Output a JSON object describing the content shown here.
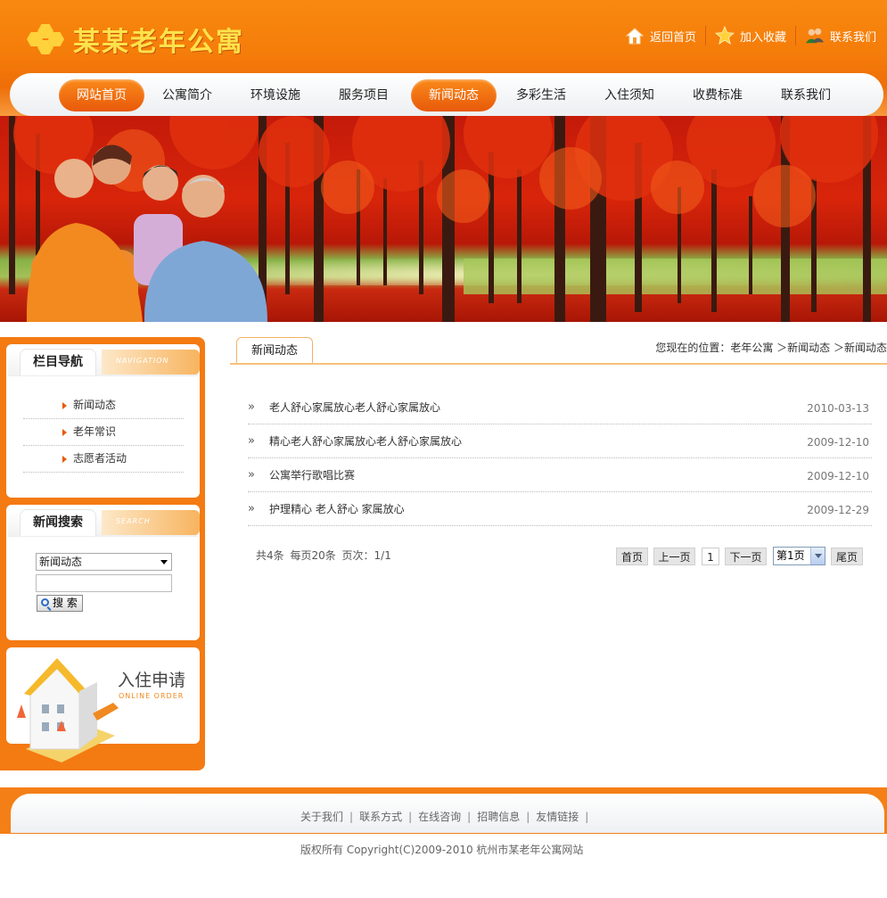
{
  "site": {
    "logo_text": "某某老年公寓",
    "top_links": [
      {
        "label": "返回首页",
        "icon": "home-icon"
      },
      {
        "label": "加入收藏",
        "icon": "star-icon"
      },
      {
        "label": "联系我们",
        "icon": "users-icon"
      }
    ],
    "nav": [
      {
        "label": "网站首页",
        "active": true
      },
      {
        "label": "公寓简介",
        "active": false
      },
      {
        "label": "环境设施",
        "active": false
      },
      {
        "label": "服务项目",
        "active": false
      },
      {
        "label": "新闻动态",
        "active": true
      },
      {
        "label": "多彩生活",
        "active": false
      },
      {
        "label": "入住须知",
        "active": false
      },
      {
        "label": "收费标准",
        "active": false
      },
      {
        "label": "联系我们",
        "active": false
      }
    ]
  },
  "sidebar": {
    "nav_panel": {
      "title": "栏目导航",
      "deco": "NAVIGATION",
      "items": [
        "新闻动态",
        "老年常识",
        "志愿者活动"
      ]
    },
    "search_panel": {
      "title": "新闻搜索",
      "deco": "SEARCH",
      "select_value": "新闻动态",
      "input_value": "",
      "button_label": "搜 索"
    },
    "apply_panel": {
      "title": "入住申请",
      "subtitle": "ONLINE ORDER"
    }
  },
  "main": {
    "tab": "新闻动态",
    "breadcrumb": "您现在的位置：老年公寓 ＞新闻动态 ＞新闻动态",
    "news": [
      {
        "title": "老人舒心家属放心老人舒心家属放心",
        "date": "2010-03-13"
      },
      {
        "title": "精心老人舒心家属放心老人舒心家属放心",
        "date": "2009-12-10"
      },
      {
        "title": "公寓举行歌唱比赛",
        "date": "2009-12-10"
      },
      {
        "title": "护理精心 老人舒心 家属放心",
        "date": "2009-12-29"
      }
    ],
    "pager": {
      "info": "共4条 每页20条 页次：1/1",
      "first": "首页",
      "prev": "上一页",
      "current": "1",
      "next": "下一页",
      "select_value": "第1页",
      "last": "尾页"
    }
  },
  "footer": {
    "links": [
      "关于我们",
      "联系方式",
      "在线咨询",
      "招聘信息",
      "友情链接"
    ],
    "copyright": "版权所有 Copyright(C)2009-2010 杭州市某老年公寓网站"
  },
  "colors": {
    "brand_orange": "#f57d0a",
    "logo_yellow": "#ffe24a",
    "active_nav": "#e8590a"
  }
}
